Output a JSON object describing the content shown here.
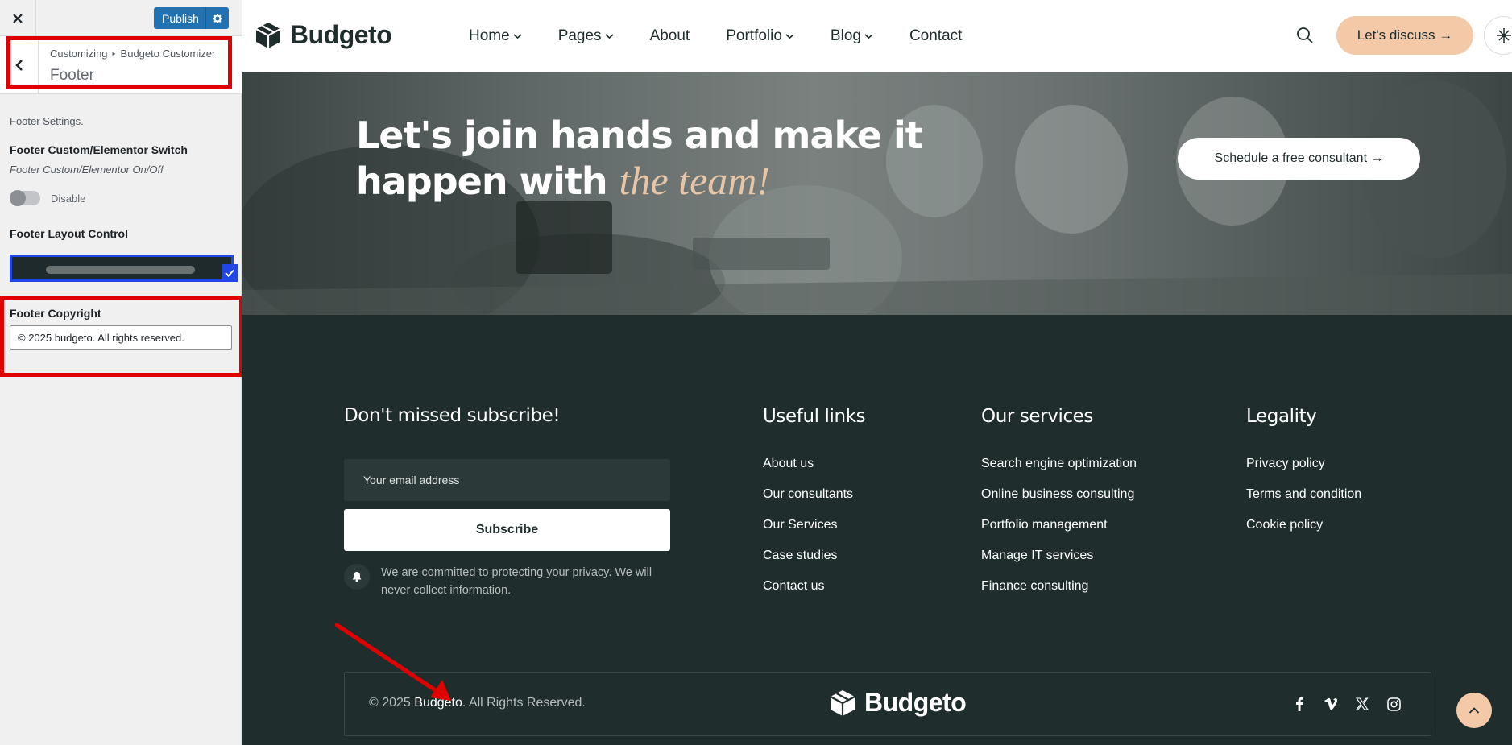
{
  "customizer": {
    "publish_label": "Publish",
    "breadcrumb": {
      "root": "Customizing",
      "separator": "▸",
      "parent": "Budgeto Customizer"
    },
    "section_title": "Footer",
    "settings_desc": "Footer Settings.",
    "switch_label": "Footer Custom/Elementor Switch",
    "switch_desc": "Footer Custom/Elementor On/Off",
    "switch_state": "Disable",
    "layout_label": "Footer Layout Control",
    "copyright_label": "Footer Copyright",
    "copyright_value": "© 2025 budgeto. All rights reserved."
  },
  "site": {
    "logo_text": "Budgeto",
    "nav": [
      {
        "label": "Home",
        "dropdown": true
      },
      {
        "label": "Pages",
        "dropdown": true
      },
      {
        "label": "About",
        "dropdown": false
      },
      {
        "label": "Portfolio",
        "dropdown": true
      },
      {
        "label": "Blog",
        "dropdown": true
      },
      {
        "label": "Contact",
        "dropdown": false
      }
    ],
    "cta_label": "Let's discuss →",
    "hero": {
      "line1": "Let's join hands and make it",
      "line2": "happen with ",
      "accent": "the team!",
      "button": "Schedule a free consultant →"
    },
    "subscribe": {
      "title": "Don't missed subscribe!",
      "email_placeholder": "Your email address",
      "button": "Subscribe",
      "privacy": "We are committed to protecting your privacy. We will never collect information."
    },
    "useful_links": {
      "title": "Useful links",
      "items": [
        "About us",
        "Our consultants",
        "Our Services",
        "Case studies",
        "Contact us"
      ]
    },
    "services": {
      "title": "Our services",
      "items": [
        "Search engine optimization",
        "Online business consulting",
        "Portfolio management",
        "Manage IT services",
        "Finance consulting"
      ]
    },
    "legality": {
      "title": "Legality",
      "items": [
        "Privacy policy",
        "Terms and condition",
        "Cookie policy"
      ]
    },
    "bottom": {
      "copy_prefix": "© 2025 ",
      "copy_brand": "Budgeto",
      "copy_suffix": ". All Rights Reserved.",
      "logo_text": "Budgeto",
      "social_icons": [
        "facebook-icon",
        "vimeo-icon",
        "x-icon",
        "instagram-icon"
      ]
    }
  },
  "colors": {
    "publish": "#2271b1",
    "highlight": "#e00000",
    "footer_bg": "#1f2d2c",
    "accent": "#f3c9a8",
    "layout_selected": "#2145e6"
  }
}
